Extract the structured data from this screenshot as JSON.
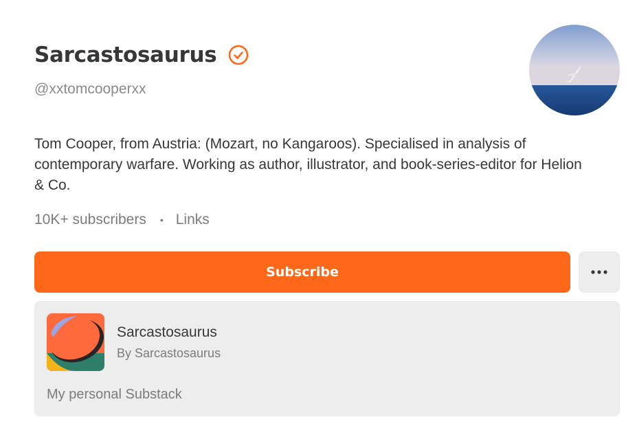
{
  "profile": {
    "name": "Sarcastosaurus",
    "handle": "@xxtomcooperxx",
    "bio": "Tom Cooper, from Austria: (Mozart, no Kangaroos). Specialised in analysis of contemporary warfare. Working as author, illustrator, and book-series-editor for Helion & Co.",
    "verified_icon": "verified-check-icon",
    "avatar": "jet-over-sea-photo"
  },
  "stats": {
    "subscribers": "10K+ subscribers",
    "separator": "•",
    "links_label": "Links"
  },
  "actions": {
    "subscribe_label": "Subscribe",
    "more_icon": "ellipsis-icon"
  },
  "publication": {
    "name": "Sarcastosaurus",
    "byline": "By Sarcastosaurus",
    "description": "My personal Substack"
  },
  "colors": {
    "accent": "#ff6719",
    "text": "#363737",
    "muted": "#7b7b7b",
    "card_bg": "#ededed"
  }
}
